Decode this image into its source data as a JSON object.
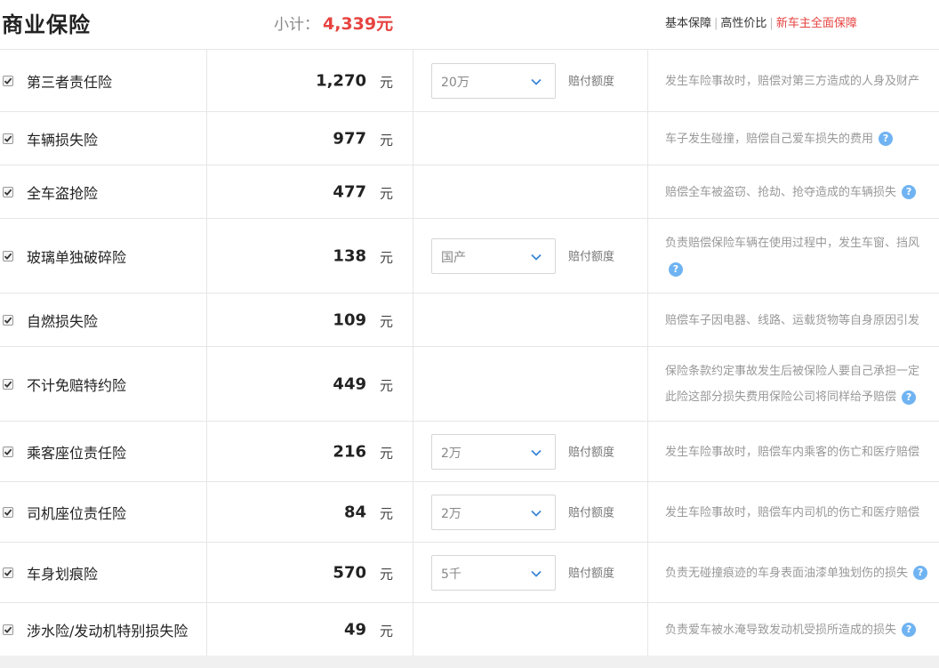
{
  "header": {
    "title": "商业保险",
    "subtotal_label": "小计：",
    "subtotal_amount": "4,339元",
    "links": [
      "基本保障",
      "高性价比",
      "新车主全面保障"
    ]
  },
  "rows": [
    {
      "name": "第三者责任险",
      "price": "1,270",
      "unit": "元",
      "select": "20万",
      "limit": "赔付额度",
      "desc1": "发生车险事故时，赔偿对第三方造成的人身及财产",
      "desc2": "",
      "help": false
    },
    {
      "name": "车辆损失险",
      "price": "977",
      "unit": "元",
      "select": "",
      "limit": "",
      "desc1": "车子发生碰撞，赔偿自己爱车损失的费用",
      "desc2": "",
      "help": true
    },
    {
      "name": "全车盗抢险",
      "price": "477",
      "unit": "元",
      "select": "",
      "limit": "",
      "desc1": "赔偿全车被盗窃、抢劫、抢夺造成的车辆损失",
      "desc2": "",
      "help": true
    },
    {
      "name": "玻璃单独破碎险",
      "price": "138",
      "unit": "元",
      "select": "国产",
      "limit": "赔付额度",
      "desc1": "负责赔偿保险车辆在使用过程中，发生车窗、挡风",
      "desc2": "",
      "help": true
    },
    {
      "name": "自燃损失险",
      "price": "109",
      "unit": "元",
      "select": "",
      "limit": "",
      "desc1": "赔偿车子因电器、线路、运载货物等自身原因引发",
      "desc2": "",
      "help": false
    },
    {
      "name": "不计免赔特约险",
      "price": "449",
      "unit": "元",
      "select": "",
      "limit": "",
      "desc1": "保险条款约定事故发生后被保险人要自己承担一定",
      "desc2": "此险这部分损失费用保险公司将同样给予赔偿",
      "help": true
    },
    {
      "name": "乘客座位责任险",
      "price": "216",
      "unit": "元",
      "select": "2万",
      "limit": "赔付额度",
      "desc1": "发生车险事故时，赔偿车内乘客的伤亡和医疗赔偿",
      "desc2": "",
      "help": false
    },
    {
      "name": "司机座位责任险",
      "price": "84",
      "unit": "元",
      "select": "2万",
      "limit": "赔付额度",
      "desc1": "发生车险事故时，赔偿车内司机的伤亡和医疗赔偿",
      "desc2": "",
      "help": false
    },
    {
      "name": "车身划痕险",
      "price": "570",
      "unit": "元",
      "select": "5千",
      "limit": "赔付额度",
      "desc1": "负责无碰撞痕迹的车身表面油漆单独划伤的损失",
      "desc2": "",
      "help": true
    },
    {
      "name": "涉水险/发动机特别损失险",
      "price": "49",
      "unit": "元",
      "select": "",
      "limit": "",
      "desc1": "负责爱车被水淹导致发动机受损所造成的损失",
      "desc2": "",
      "help": true
    }
  ],
  "help_glyph": "?",
  "colors": {
    "accent_red": "#e64340",
    "help_blue": "#6fb3f2"
  }
}
